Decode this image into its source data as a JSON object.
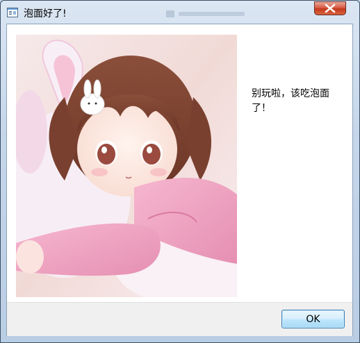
{
  "window": {
    "title": "泡面好了!",
    "icon": "app-window-icon",
    "close_icon": "close-x-icon"
  },
  "dialog": {
    "image": "anime-girl-pink-bunny-illustration",
    "message": "别玩啦，该吃泡面了！",
    "ok_label": "OK"
  },
  "colors": {
    "close_button": "#d7563f",
    "ok_border": "#3c7fb1",
    "footer": "#f0f0f0"
  }
}
